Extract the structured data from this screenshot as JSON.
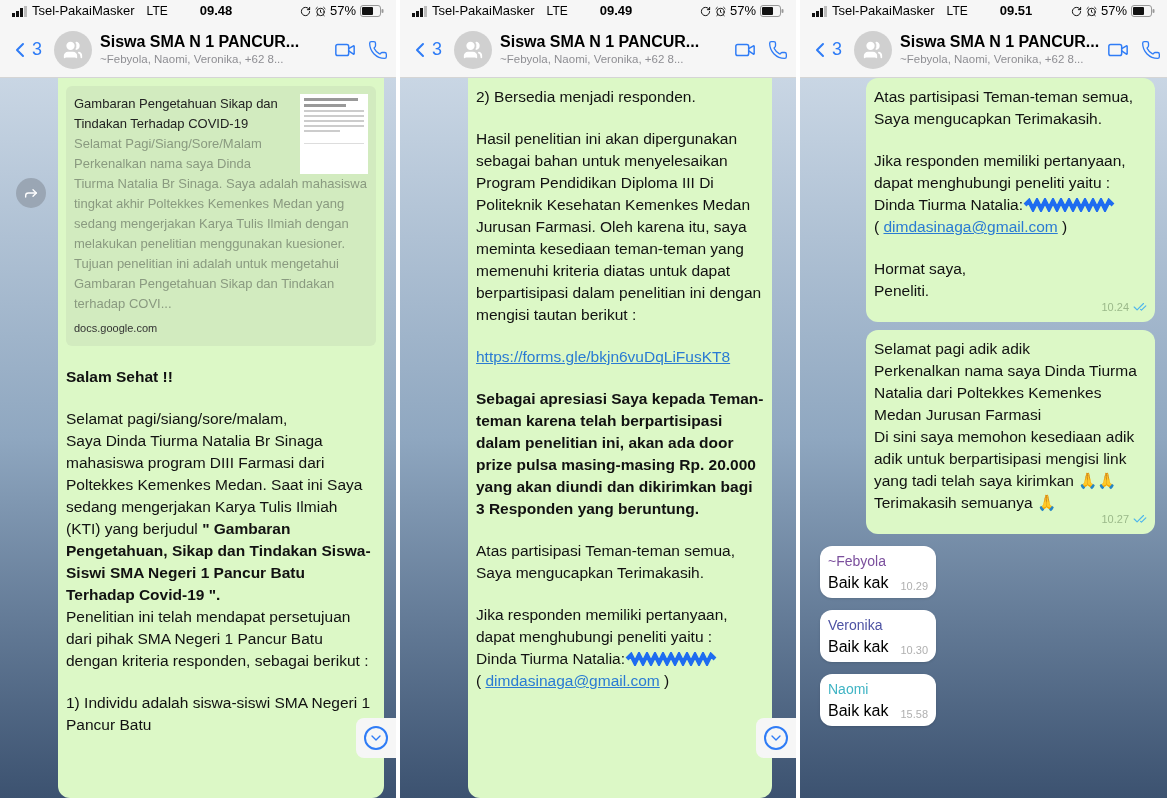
{
  "panels": [
    {
      "status_bar": {
        "carrier": "Tsel-PakaiMasker",
        "network": "LTE",
        "time": "09.48",
        "battery": "57%"
      },
      "header": {
        "back_count": "3",
        "title": "Siswa SMA N 1 PANCUR...",
        "subtitle": "~Febyola, Naomi, Veronika, +62 8..."
      },
      "forward_button": true,
      "scroll_down_button": true,
      "messages": [
        {
          "kind": "outgoing",
          "blocks": [
            {
              "kind": "preview",
              "title": "Gambaran Pengetahuan Sikap dan Tindakan Terhadap COVID-19",
              "description": "Selamat Pagi/Siang/Sore/Malam Perkenalkan nama saya Dinda Tiurma Natalia Br Sinaga. Saya adalah mahasiswa tingkat akhir Poltekkes Kemenkes Medan yang sedang mengerjakan Karya Tulis Ilmiah dengan melakukan penelitian menggunakan kuesioner. Tujuan penelitian ini adalah untuk mengetahui Gambaran Pengetahuan Sikap dan Tindakan  terhadap COVI...",
              "domain": "docs.google.com"
            },
            {
              "kind": "text",
              "bold": true,
              "lines": [
                "Salam Sehat !!"
              ]
            },
            {
              "kind": "text",
              "lines": [
                "Selamat pagi/siang/sore/malam,",
                "Saya Dinda Tiurma Natalia Br Sinaga mahasiswa program DIII Farmasi dari Poltekkes Kemenkes Medan. Saat ini Saya sedang mengerjakan Karya Tulis Ilmiah (KTI) yang berjudul **\" Gambaran Pengetahuan, Sikap dan Tindakan Siswa-Siswi SMA Negeri 1 Pancur Batu Terhadap Covid-19  \".**",
                "Penelitian ini telah mendapat persetujuan dari pihak SMA Negeri 1 Pancur Batu dengan kriteria responden, sebagai berikut :"
              ]
            },
            {
              "kind": "text",
              "lines": [
                "1) Individu adalah siswa-siswi SMA Negeri 1 Pancur Batu"
              ]
            }
          ]
        }
      ]
    },
    {
      "status_bar": {
        "carrier": "Tsel-PakaiMasker",
        "network": "LTE",
        "time": "09.49",
        "battery": "57%"
      },
      "header": {
        "back_count": "3",
        "title": "Siswa SMA N 1 PANCUR...",
        "subtitle": "~Febyola, Naomi, Veronika, +62 8..."
      },
      "scroll_down_button": true,
      "messages": [
        {
          "kind": "outgoing",
          "blocks": [
            {
              "kind": "text",
              "lines": [
                "2) Bersedia menjadi responden."
              ]
            },
            {
              "kind": "text",
              "lines": [
                "Hasil penelitian ini akan dipergunakan sebagai bahan untuk menyelesaikan Program Pendidikan Diploma III Di Politeknik Kesehatan Kemenkes Medan Jurusan Farmasi. Oleh karena itu, saya meminta kesediaan teman-teman yang memenuhi kriteria diatas untuk dapat berpartisipasi dalam penelitian ini dengan mengisi tautan berikut :"
              ]
            },
            {
              "kind": "link",
              "url": "https://forms.gle/bkjn6vuDqLiFusKT8"
            },
            {
              "kind": "text",
              "bold": true,
              "lines": [
                "Sebagai apresiasi Saya kepada Teman-teman karena telah berpartisipasi dalam penelitian ini, akan ada door prize pulsa masing-masing Rp. 20.000 yang akan diundi dan dikirimkan bagi 3 Responden yang beruntung."
              ]
            },
            {
              "kind": "text",
              "lines": [
                "Atas partisipasi Teman-teman semua,",
                "Saya mengucapkan Terimakasih."
              ]
            },
            {
              "kind": "contact",
              "lines": [
                "Jika responden memiliki pertanyaan,",
                "dapat menghubungi peneliti yaitu :"
              ],
              "name": "Dinda Tiurma Natalia:",
              "email": {
                "open": "(",
                "address": "dimdasinaga@gmail.com",
                "close": ")"
              }
            }
          ]
        }
      ]
    },
    {
      "status_bar": {
        "carrier": "Tsel-PakaiMasker",
        "network": "LTE",
        "time": "09.51",
        "battery": "57%"
      },
      "header": {
        "back_count": "3",
        "title": "Siswa SMA N 1 PANCUR...",
        "subtitle": "~Febyola, Naomi, Veronika, +62 8..."
      },
      "messages": [
        {
          "kind": "outgoing",
          "time": "10.24",
          "read": true,
          "blocks": [
            {
              "kind": "text",
              "lines": [
                "Atas partisipasi Teman-teman semua,",
                "Saya mengucapkan Terimakasih."
              ]
            },
            {
              "kind": "contact",
              "lines": [
                "Jika responden memiliki pertanyaan,",
                "dapat menghubungi peneliti yaitu :"
              ],
              "name": "Dinda Tiurma Natalia:",
              "email": {
                "open": "(",
                "address": "dimdasinaga@gmail.com",
                "close": ")"
              }
            },
            {
              "kind": "text",
              "lines": [
                "Hormat saya,",
                "Peneliti."
              ]
            }
          ]
        },
        {
          "kind": "outgoing",
          "time": "10.27",
          "read": true,
          "blocks": [
            {
              "kind": "text",
              "lines": [
                "Selamat pagi adik adik",
                "Perkenalkan nama saya Dinda Tiurma Natalia dari Poltekkes Kemenkes Medan Jurusan Farmasi",
                "Di sini saya memohon kesediaan adik adik untuk berpartisipasi mengisi link yang tadi telah saya kirimkan 🙏🙏",
                "Terimakasih semuanya 🙏"
              ]
            }
          ]
        },
        {
          "kind": "incoming",
          "sender": "~Febyola",
          "color": "#7b4f9d",
          "time": "10.29",
          "blocks": [
            {
              "kind": "text",
              "lines": [
                "Baik kak"
              ]
            }
          ]
        },
        {
          "kind": "incoming",
          "sender": "Veronika",
          "color": "#4d52a3",
          "time": "10.30",
          "blocks": [
            {
              "kind": "text",
              "lines": [
                "Baik kak"
              ]
            }
          ]
        },
        {
          "kind": "incoming",
          "sender": "Naomi",
          "color": "#3fb4c4",
          "time": "15.58",
          "blocks": [
            {
              "kind": "text",
              "lines": [
                "Baik kak"
              ]
            }
          ]
        }
      ]
    }
  ]
}
